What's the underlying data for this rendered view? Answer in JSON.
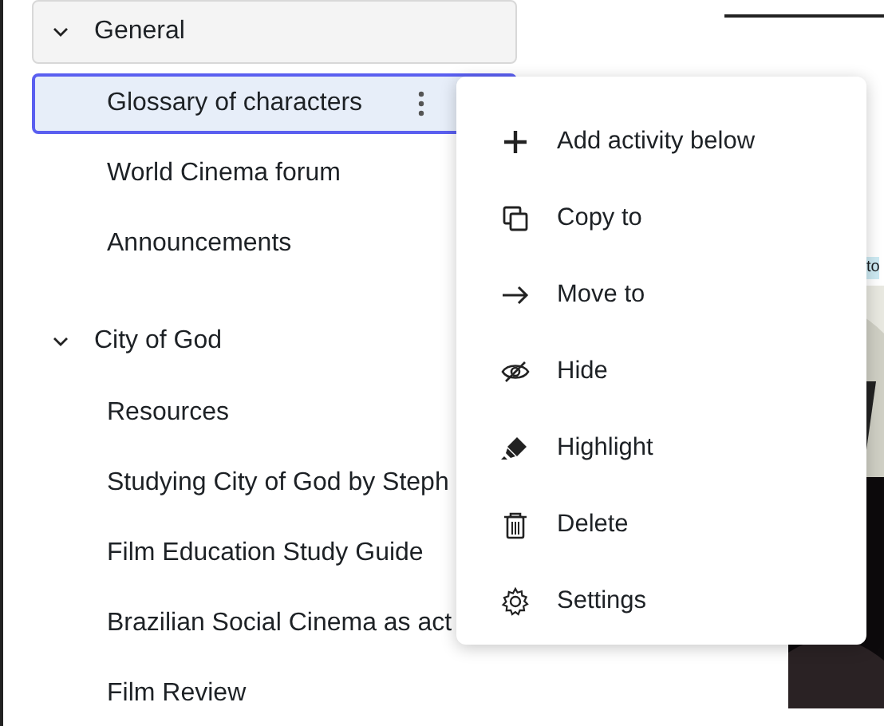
{
  "sections": [
    {
      "title": "General",
      "expanded": true,
      "highlighted": true,
      "items": [
        {
          "label": "Glossary of characters",
          "selected": true
        },
        {
          "label": "World Cinema forum",
          "selected": false
        },
        {
          "label": "Announcements",
          "selected": false
        }
      ]
    },
    {
      "title": "City of God",
      "expanded": true,
      "highlighted": false,
      "items": [
        {
          "label": "Resources",
          "selected": false
        },
        {
          "label": "Studying City of God by Steph",
          "selected": false
        },
        {
          "label": "Film Education Study Guide",
          "selected": false
        },
        {
          "label": "Brazilian Social Cinema as act",
          "selected": false
        },
        {
          "label": "Film Review",
          "selected": false
        }
      ]
    }
  ],
  "context_menu": {
    "items": [
      {
        "kind": "add",
        "label": "Add activity below"
      },
      {
        "kind": "copy",
        "label": "Copy to"
      },
      {
        "kind": "move",
        "label": "Move to"
      },
      {
        "kind": "hide",
        "label": "Hide"
      },
      {
        "kind": "highlight",
        "label": "Highlight"
      },
      {
        "kind": "delete",
        "label": "Delete"
      },
      {
        "kind": "settings",
        "label": "Settings"
      }
    ]
  },
  "main": {
    "tag": "to"
  }
}
